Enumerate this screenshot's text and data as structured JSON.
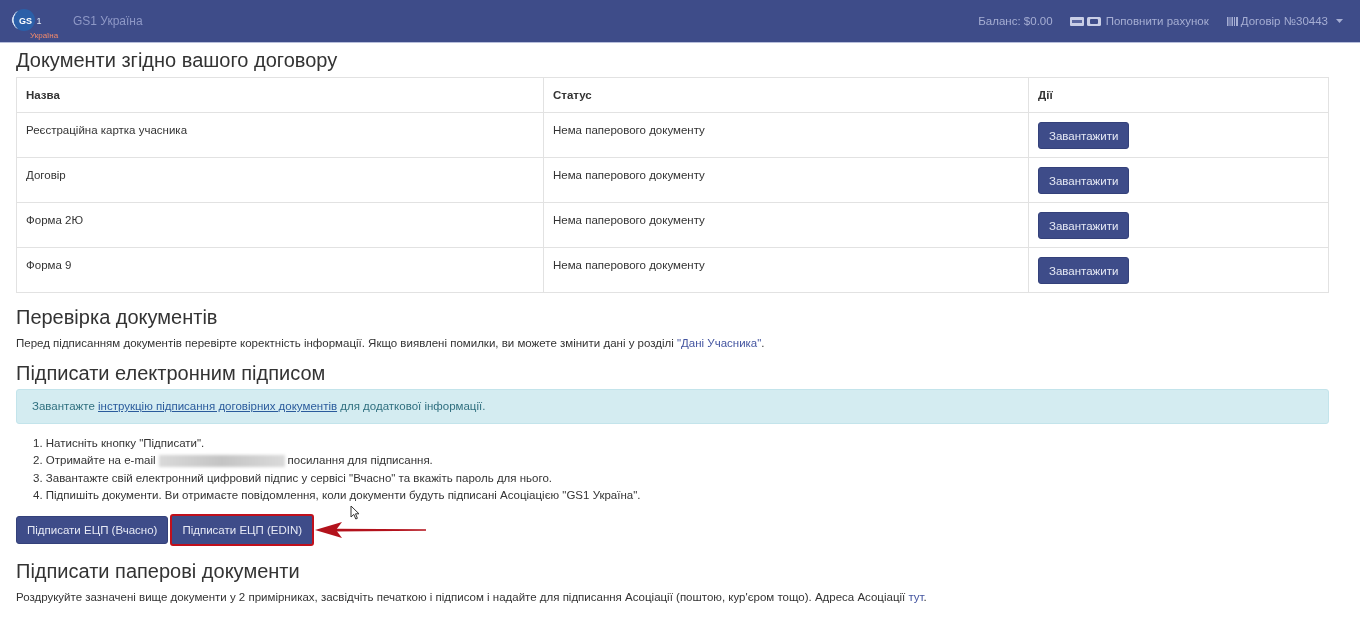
{
  "navbar": {
    "logo": {
      "letters": "GS",
      "digit": "1",
      "subtitle": "Україна"
    },
    "brand": "GS1 Україна",
    "balance": "Баланс: $0.00",
    "top_up": "Поповнити рахунок",
    "contract": "Договір №30443"
  },
  "documents": {
    "title": "Документи згідно вашого договору",
    "columns": [
      "Назва",
      "Статус",
      "Дії"
    ],
    "rows": [
      {
        "name": "Реєстраційна картка учасника",
        "status": "Нема паперового документу",
        "action": "Завантажити"
      },
      {
        "name": "Договір",
        "status": "Нема паперового документу",
        "action": "Завантажити"
      },
      {
        "name": "Форма 2Ю",
        "status": "Нема паперового документу",
        "action": "Завантажити"
      },
      {
        "name": "Форма 9",
        "status": "Нема паперового документу",
        "action": "Завантажити"
      }
    ]
  },
  "check": {
    "title": "Перевірка документів",
    "text_before": "Перед підписанням документів перевірте коректність інформації. Якщо виявлені помилки, ви можете змінити дані у розділі",
    "link": "\"Дані Учасника\"",
    "text_after": "."
  },
  "e_sign": {
    "title": "Підписати електронним підписом",
    "info": {
      "before": "Завантажте",
      "link": "інструкцію підписання договірних документів",
      "after": "для додаткової інформації."
    },
    "steps": [
      {
        "kind": "plain",
        "text": "1. Натисніть кнопку \"Підписати\"."
      },
      {
        "kind": "redacted",
        "before": "2. Отримайте на e-mail",
        "after": "посилання для підписання."
      },
      {
        "kind": "plain",
        "text": "3. Завантажте свій електронний цифровий підпис у сервісі \"Вчасно\" та вкажіть пароль для нього."
      },
      {
        "kind": "plain",
        "text": "4. Підпишіть документи. Ви отримаєте повідомлення, коли документи будуть підписані Асоціацією \"GS1 Україна\"."
      }
    ],
    "buttons": [
      {
        "label": "Підписати ЕЦП (Вчасно)",
        "highlighted": false
      },
      {
        "label": "Підписати ЕЦП (EDIN)",
        "highlighted": true
      }
    ]
  },
  "paper": {
    "title": "Підписати паперові документи",
    "text_before": "Роздрукуйте зазначені вище документи у 2 примірниках, засвідчіть печаткою і підписом і надайте для підписання Асоціації (поштою, кур'єром тощо). Адреса Асоціації",
    "link": "тут",
    "text_after": "."
  }
}
